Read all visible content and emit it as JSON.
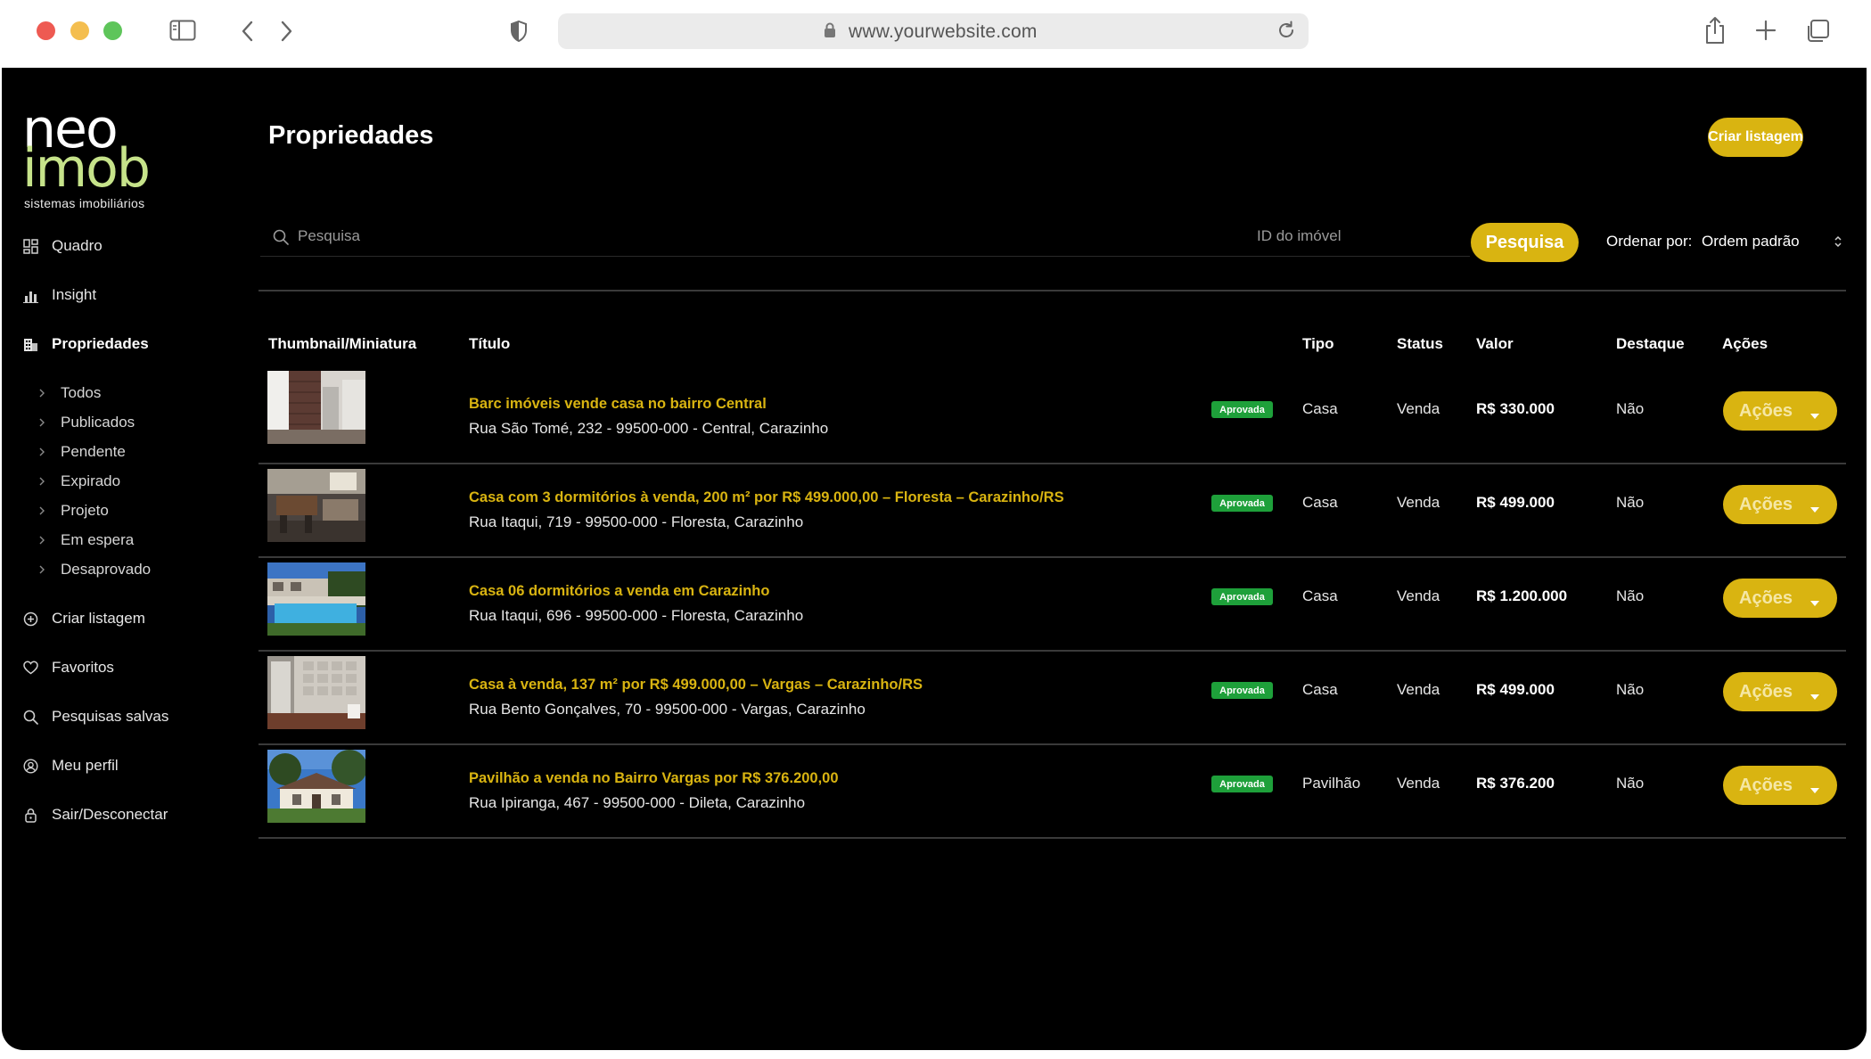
{
  "browser": {
    "url": "www.yourwebsite.com"
  },
  "logo": {
    "line1": "neo",
    "line2": "imob",
    "tagline": "sistemas imobiliários"
  },
  "sidebar": {
    "items": [
      {
        "label": "Quadro",
        "icon": "dashboard-icon"
      },
      {
        "label": "Insight",
        "icon": "bar-chart-icon"
      },
      {
        "label": "Propriedades",
        "icon": "building-icon"
      },
      {
        "label": "Criar listagem",
        "icon": "plus-circle-icon"
      },
      {
        "label": "Favoritos",
        "icon": "heart-icon"
      },
      {
        "label": "Pesquisas salvas",
        "icon": "search-icon"
      },
      {
        "label": "Meu perfil",
        "icon": "user-circle-icon"
      },
      {
        "label": "Sair/Desconectar",
        "icon": "lock-icon"
      }
    ],
    "subitems": [
      "Todos",
      "Publicados",
      "Pendente",
      "Expirado",
      "Projeto",
      "Em espera",
      "Desaprovado"
    ]
  },
  "header": {
    "title": "Propriedades",
    "create_label": "Criar listagem"
  },
  "search": {
    "placeholder": "Pesquisa",
    "id_placeholder": "ID do imóvel",
    "button_label": "Pesquisa",
    "sort_label": "Ordenar por:",
    "sort_value": "Ordem padrão"
  },
  "table": {
    "columns": [
      "Thumbnail/Miniatura",
      "Título",
      "Tipo",
      "Status",
      "Valor",
      "Destaque",
      "Ações"
    ],
    "rows": [
      {
        "title": "Barc imóveis vende casa no bairro Central",
        "address": "Rua São Tomé, 232 - 99500-000 - Central, Carazinho",
        "badge": "Aprovada",
        "type": "Casa",
        "status": "Venda",
        "value": "R$ 330.000",
        "featured": "Não",
        "action": "Ações"
      },
      {
        "title": "Casa com 3 dormitórios à venda, 200 m² por R$ 499.000,00 – Floresta – Carazinho/RS",
        "address": "Rua Itaqui, 719 - 99500-000 - Floresta, Carazinho",
        "badge": "Aprovada",
        "type": "Casa",
        "status": "Venda",
        "value": "R$ 499.000",
        "featured": "Não",
        "action": "Ações"
      },
      {
        "title": "Casa 06 dormitórios a venda em Carazinho",
        "address": "Rua Itaqui, 696 - 99500-000 - Floresta, Carazinho",
        "badge": "Aprovada",
        "type": "Casa",
        "status": "Venda",
        "value": "R$ 1.200.000",
        "featured": "Não",
        "action": "Ações"
      },
      {
        "title": "Casa à venda, 137 m² por R$ 499.000,00 – Vargas – Carazinho/RS",
        "address": "Rua Bento Gonçalves, 70 - 99500-000 - Vargas, Carazinho",
        "badge": "Aprovada",
        "type": "Casa",
        "status": "Venda",
        "value": "R$ 499.000",
        "featured": "Não",
        "action": "Ações"
      },
      {
        "title": "Pavilhão a venda no Bairro Vargas por R$ 376.200,00",
        "address": "Rua Ipiranga, 467 - 99500-000 - Dileta, Carazinho",
        "badge": "Aprovada",
        "type": "Pavilhão",
        "status": "Venda",
        "value": "R$ 376.200",
        "featured": "Não",
        "action": "Ações"
      }
    ]
  },
  "colors": {
    "accent": "#d9b411",
    "logo_green": "#c6e38a",
    "badge_green": "#1ea03a",
    "background": "#000000"
  }
}
